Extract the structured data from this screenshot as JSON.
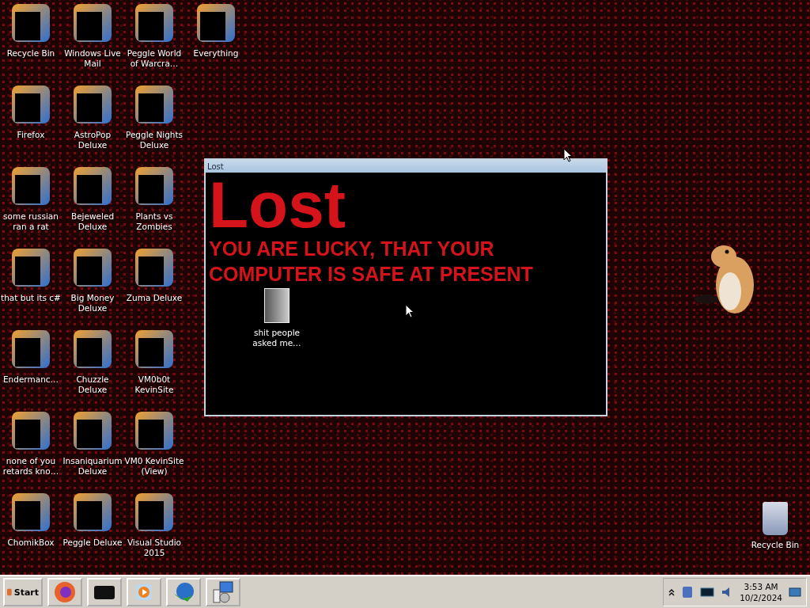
{
  "desktop": {
    "icon_rows": [
      [
        {
          "label": "Recycle Bin"
        },
        {
          "label": "Windows Live Mail"
        },
        {
          "label": "Peggle World of Warcra…"
        },
        {
          "label": "Everything"
        }
      ],
      [
        {
          "label": "Firefox"
        },
        {
          "label": "AstroPop Deluxe"
        },
        {
          "label": "Peggle Nights Deluxe"
        }
      ],
      [
        {
          "label": "some russian ran a rat"
        },
        {
          "label": "Bejeweled Deluxe"
        },
        {
          "label": "Plants vs Zombies"
        }
      ],
      [
        {
          "label": "that but its c#"
        },
        {
          "label": "Big Money Deluxe"
        },
        {
          "label": "Zuma Deluxe"
        }
      ],
      [
        {
          "label": "Endermanc…"
        },
        {
          "label": "Chuzzle Deluxe"
        },
        {
          "label": "VM0b0t KevinSite"
        }
      ],
      [
        {
          "label": "none of you retards kno…"
        },
        {
          "label": "Insaniquarium Deluxe"
        },
        {
          "label": "VM0 KevinSite (View)"
        }
      ],
      [
        {
          "label": "ChomikBox"
        },
        {
          "label": "Peggle Deluxe"
        },
        {
          "label": "Visual Studio 2015"
        }
      ]
    ],
    "window": {
      "title": "Lost",
      "heading": "Lost",
      "message": "YOU ARE LUCKY, THAT YOUR COMPUTER IS SAFE AT PRESENT"
    },
    "folder": {
      "label": "shit people asked me…"
    },
    "recycle_bin": {
      "label": "Recycle Bin"
    }
  },
  "taskbar": {
    "start": "Start",
    "clock": {
      "time": "3:53 AM",
      "date": "10/2/2024"
    }
  }
}
